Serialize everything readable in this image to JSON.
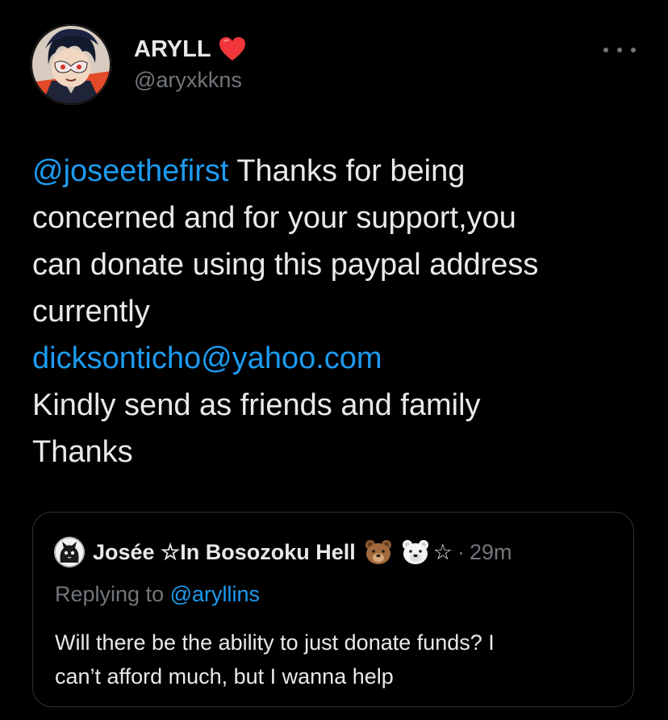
{
  "author": {
    "display_name": "ARYLL",
    "handle": "@aryxkkns",
    "name_badge_icon": "red-heart-icon"
  },
  "menu": {
    "icon": "more-horizontal-icon"
  },
  "tweet": {
    "mention": "@joseethefirst",
    "line1_rest": " Thanks for being",
    "line2": "concerned and for your support,you",
    "line3": "can donate using this paypal address",
    "line4": "currently",
    "email": "dicksonticho@yahoo.com",
    "line6": "Kindly send as friends and family",
    "line7": "Thanks"
  },
  "quoted": {
    "name": "Josée ☆In Bosozoku Hell",
    "emoji": [
      "bear-face-icon",
      "polar-bear-icon"
    ],
    "trailing_star": "☆",
    "separator": "·",
    "time": "29m",
    "replying_prefix": "Replying to ",
    "replying_handle": "@aryllins",
    "text_line1": "Will there be the ability to just donate funds? I",
    "text_line2": "can’t afford much, but I wanna help"
  },
  "colors": {
    "background": "#000000",
    "text": "#e7e9ea",
    "secondary": "#71767b",
    "link": "#1d9bf0",
    "border": "#2f3336"
  }
}
